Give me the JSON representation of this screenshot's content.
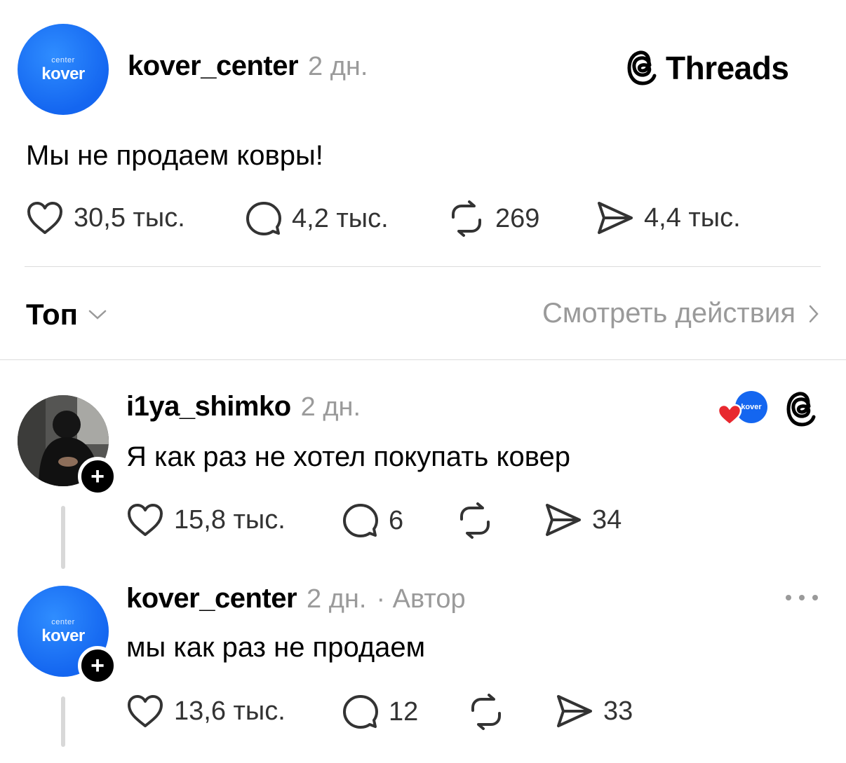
{
  "post": {
    "avatar_small_text": "center",
    "avatar_text": "kover",
    "username": "kover_center",
    "time": "2 дн.",
    "brand": "Threads",
    "text": "Мы не продаем ковры!",
    "likes": "30,5 тыс.",
    "replies": "4,2 тыс.",
    "reposts": "269",
    "shares": "4,4 тыс."
  },
  "sort": {
    "label": "Топ",
    "view_activity": "Смотреть действия"
  },
  "replies": [
    {
      "username": "i1ya_shimko",
      "time": "2 дн.",
      "text": "Я как раз не хотел покупать ковер",
      "liked_by_author_avatar_text": "kover",
      "likes": "15,8 тыс.",
      "replies": "6",
      "reposts": "",
      "shares": "34"
    },
    {
      "username": "kover_center",
      "time": "2 дн.",
      "author_tag": "· Автор",
      "avatar_small_text": "center",
      "avatar_text": "kover",
      "text": "мы как раз не продаем",
      "likes": "13,6 тыс.",
      "replies": "12",
      "reposts": "",
      "shares": "33"
    }
  ],
  "icons": {
    "like": "heart-outline-icon",
    "reply": "speech-bubble-icon",
    "repost": "repost-arrows-icon",
    "share": "paper-plane-icon",
    "threads": "threads-logo-icon",
    "more": "ellipsis-icon"
  },
  "colors": {
    "kover_blue": "#1466f0",
    "heart_red": "#e8282f",
    "muted_text": "#9a9a9a"
  }
}
